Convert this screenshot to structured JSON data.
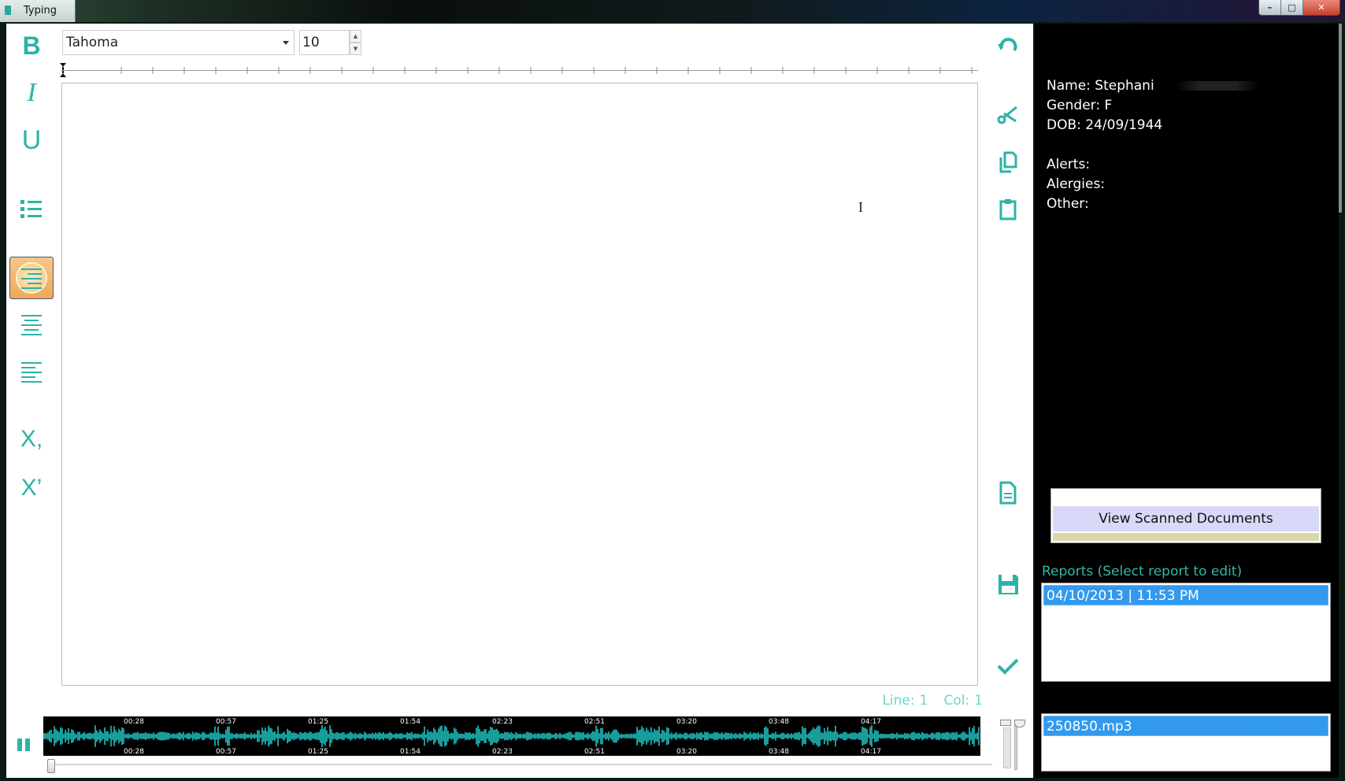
{
  "window": {
    "title": "Typing",
    "buttons": [
      "–",
      "□",
      "✕"
    ]
  },
  "format_toolbar": {
    "bold_label": "B",
    "italic_label": "I",
    "underline_label": "U",
    "subscript_label": "X,",
    "superscript_label": "X’",
    "active_tool": "align-right"
  },
  "font": {
    "family": "Tahoma",
    "size": "10"
  },
  "status": {
    "line_label": "Line:",
    "line_value": "1",
    "col_label": "Col:",
    "col_value": "1"
  },
  "playback": {
    "state": "playing",
    "position": 0,
    "timestamps": [
      "00:28",
      "00:57",
      "01:25",
      "01:54",
      "02:23",
      "02:51",
      "03:20",
      "03:48",
      "04:17"
    ]
  },
  "patient": {
    "name_label": "Name: Stephani",
    "gender_label": "Gender: F",
    "dob_label": "DOB: 24/09/1944",
    "alerts_label": "Alerts:",
    "allergies_label": "Alergies:",
    "other_label": "Other:"
  },
  "scan_button_label": "View Scanned Documents",
  "reports": {
    "label": "Reports (Select report to edit)",
    "items": [
      "04/10/2013 | 11:53 PM"
    ]
  },
  "audio_files": {
    "items": [
      "250850.mp3"
    ]
  },
  "colors": {
    "accent": "#2cb3a6",
    "selection": "#3399ee",
    "scan_button": "#d8d8f8"
  },
  "icons": {
    "right_toolbar": [
      "undo-icon",
      "cut-icon",
      "copy-icon",
      "paste-icon",
      "document-icon",
      "save-icon",
      "check-icon"
    ]
  }
}
